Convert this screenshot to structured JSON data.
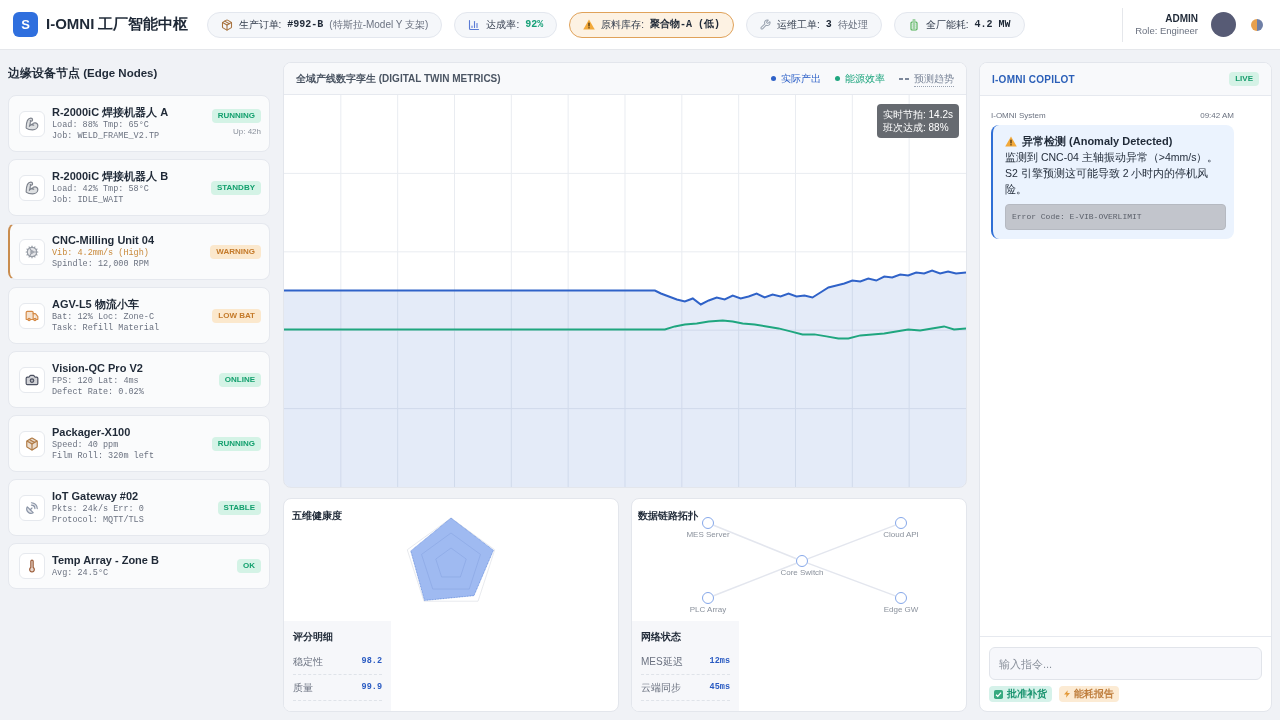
{
  "header": {
    "logo": {
      "letter": "S",
      "title": "I-OMNI 工厂智能中枢"
    },
    "stats": [
      {
        "kind": "order",
        "warning": false,
        "positive": false,
        "label": "生产订单:",
        "value": "#992-B",
        "note": "(特斯拉-Model Y 支架)"
      },
      {
        "kind": "rate",
        "warning": false,
        "positive": true,
        "label": "达成率:",
        "value": "92%"
      },
      {
        "kind": "stock",
        "warning": true,
        "positive": false,
        "label": "原料库存:",
        "value": "聚合物-A (低)"
      },
      {
        "kind": "maintenance",
        "warning": false,
        "positive": false,
        "label": "运维工单:",
        "value": "3",
        "note": "待处理"
      },
      {
        "kind": "energy",
        "warning": false,
        "positive": false,
        "label": "全厂能耗:",
        "value": "4.2 MW"
      }
    ],
    "user": {
      "name": "ADMIN",
      "role": "Role: Engineer"
    }
  },
  "sidebar": {
    "title": "边缘设备节点 (Edge Nodes)",
    "nodes": [
      {
        "kind": "robot",
        "name": "R-2000iC 焊接机器人 A",
        "flagged": false,
        "lines": [
          {
            "text": "Load: 88% Tmp: 65°C",
            "alert": false
          },
          {
            "text": "Job: WELD_FRAME_V2.TP",
            "alert": false
          }
        ],
        "status": "RUNNING",
        "warning": false,
        "extra": "Up: 42h"
      },
      {
        "kind": "robot",
        "name": "R-2000iC 焊接机器人 B",
        "flagged": false,
        "lines": [
          {
            "text": "Load: 42% Tmp: 58°C",
            "alert": false
          },
          {
            "text": "Job: IDLE_WAIT",
            "alert": false
          }
        ],
        "status": "STANDBY",
        "warning": false
      },
      {
        "kind": "cnc",
        "name": "CNC-Milling Unit 04",
        "flagged": true,
        "lines": [
          {
            "text": "Vib: 4.2mm/s (High)",
            "alert": true
          },
          {
            "text": "Spindle: 12,000 RPM",
            "alert": false
          }
        ],
        "status": "WARNING",
        "warning": true
      },
      {
        "kind": "agv",
        "name": "AGV-L5 物流小车",
        "flagged": false,
        "lines": [
          {
            "text": "Bat: 12% Loc: Zone-C",
            "alert": false
          },
          {
            "text": "Task: Refill Material",
            "alert": false
          }
        ],
        "status": "LOW BAT",
        "warning": true
      },
      {
        "kind": "camera",
        "name": "Vision-QC Pro V2",
        "flagged": false,
        "lines": [
          {
            "text": "FPS: 120 Lat: 4ms",
            "alert": false
          },
          {
            "text": "Defect Rate: 0.02%",
            "alert": false
          }
        ],
        "status": "ONLINE",
        "warning": false
      },
      {
        "kind": "packager",
        "name": "Packager-X100",
        "flagged": false,
        "lines": [
          {
            "text": "Speed: 40 ppm",
            "alert": false
          },
          {
            "text": "Film Roll: 320m left",
            "alert": false
          }
        ],
        "status": "RUNNING",
        "warning": false
      },
      {
        "kind": "gateway",
        "name": "IoT Gateway #02",
        "flagged": false,
        "lines": [
          {
            "text": "Pkts: 24k/s Err: 0",
            "alert": false
          },
          {
            "text": "Protocol: MQTT/TLS",
            "alert": false
          }
        ],
        "status": "STABLE",
        "warning": false
      },
      {
        "kind": "sensor",
        "name": "Temp Array - Zone B",
        "flagged": false,
        "lines": [
          {
            "text": "Avg: 24.5°C",
            "alert": false
          }
        ],
        "status": "OK",
        "warning": false
      }
    ]
  },
  "twin_chart": {
    "title": "全域产线数字孪生 (DIGITAL TWIN METRICS)",
    "legend": [
      {
        "kind": "dot",
        "label": "实际产出",
        "color": "#2f62c8"
      },
      {
        "kind": "dot",
        "label": "能源效率",
        "color": "#1fa67f"
      },
      {
        "kind": "dash",
        "label": "预测趋势",
        "color": "#7b8699"
      }
    ],
    "tooltip": [
      "实时节拍: 14.2s",
      "班次达成: 88%"
    ]
  },
  "health_panel": {
    "title": "五维健康度",
    "scores": {
      "title": "评分明细",
      "rows": [
        {
          "label": "稳定性",
          "value": "98.2"
        },
        {
          "label": "质量",
          "value": "99.9"
        }
      ]
    }
  },
  "topology_panel": {
    "title": "数据链路拓扑",
    "nodes": [
      {
        "kind": "endpoint",
        "label": "MES Server"
      },
      {
        "kind": "endpoint",
        "label": "Cloud API"
      },
      {
        "kind": "hub",
        "label": "Core Switch"
      },
      {
        "kind": "endpoint",
        "label": "PLC Array"
      },
      {
        "kind": "endpoint",
        "label": "Edge GW"
      }
    ],
    "network": {
      "title": "网络状态",
      "rows": [
        {
          "label": "MES延迟",
          "value": "12ms"
        },
        {
          "label": "云端同步",
          "value": "45ms"
        }
      ]
    }
  },
  "copilot": {
    "title": "I-OMNI COPILOT",
    "badge": "LIVE",
    "messages": [
      {
        "sender": "I-OMNI System",
        "time": "09:42 AM",
        "title": "异常检测 (Anomaly Detected)",
        "body": "监测到 CNC-04 主轴振动异常（>4mm/s）。S2 引擎预测这可能导致 2 小时内的停机风险。",
        "code": "Error Code: E-VIB-OVERLIMIT"
      }
    ],
    "input": {
      "placeholder": "输入指令..."
    },
    "actions": [
      {
        "kind": "approve",
        "label": "批准补货"
      },
      {
        "kind": "report",
        "label": "能耗报告"
      }
    ]
  }
}
